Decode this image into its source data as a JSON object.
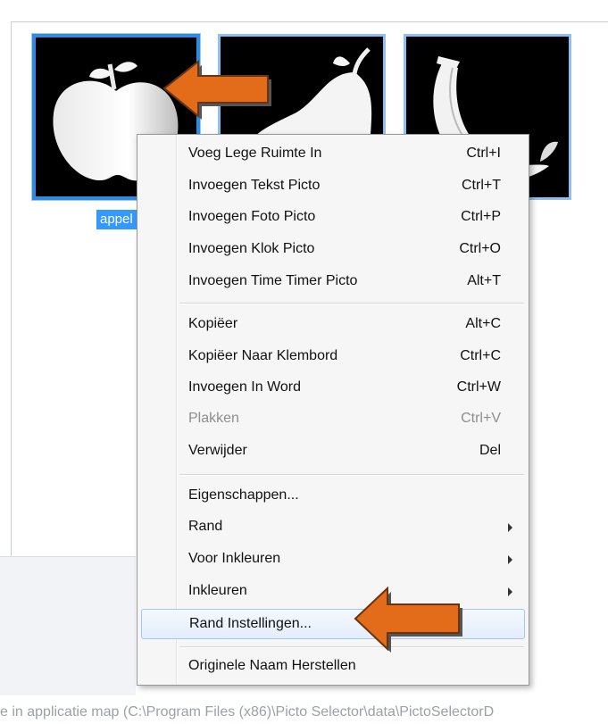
{
  "thumbnails": [
    {
      "name": "apple",
      "label": "appel",
      "selected": true
    },
    {
      "name": "pear",
      "label": "",
      "selected": false
    },
    {
      "name": "banana",
      "label": "",
      "selected": false
    }
  ],
  "context_menu": {
    "items": [
      {
        "label": "Voeg Lege Ruimte In",
        "shortcut": "Ctrl+I"
      },
      {
        "label": "Invoegen Tekst Picto",
        "shortcut": "Ctrl+T"
      },
      {
        "label": "Invoegen Foto Picto",
        "shortcut": "Ctrl+P"
      },
      {
        "label": "Invoegen Klok Picto",
        "shortcut": "Ctrl+O"
      },
      {
        "label": "Invoegen Time Timer Picto",
        "shortcut": "Alt+T"
      },
      {
        "label": "Kopiëer",
        "shortcut": "Alt+C"
      },
      {
        "label": "Kopiëer Naar Klembord",
        "shortcut": "Ctrl+C"
      },
      {
        "label": "Invoegen In Word",
        "shortcut": "Ctrl+W"
      },
      {
        "label": "Plakken",
        "shortcut": "Ctrl+V",
        "disabled": true
      },
      {
        "label": "Verwijder",
        "shortcut": "Del"
      },
      {
        "label": "Eigenschappen...",
        "shortcut": ""
      },
      {
        "label": "Rand",
        "shortcut": "",
        "submenu": true
      },
      {
        "label": "Voor Inkleuren",
        "shortcut": "",
        "submenu": true
      },
      {
        "label": "Inkleuren",
        "shortcut": "",
        "submenu": true
      },
      {
        "label": "Rand Instellingen...",
        "shortcut": "",
        "highlighted": true
      },
      {
        "label": "Originele Naam Herstellen",
        "shortcut": ""
      }
    ]
  },
  "status_bar": {
    "text": "e in applicatie map (C:\\Program Files (x86)\\Picto Selector\\data\\PictoSelectorD"
  },
  "colors": {
    "selection": "#3399ff",
    "arrow": "#e36c1a",
    "highlight_border": "#a9c6ea"
  }
}
